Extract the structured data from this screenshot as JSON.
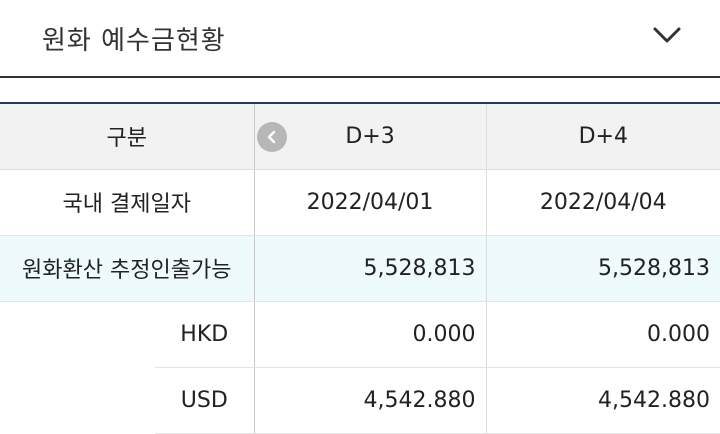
{
  "header": {
    "title": "원화 예수금현황",
    "toggle_icon": "chevron-down-icon"
  },
  "table": {
    "header": {
      "label": "구분",
      "col1": "D+3",
      "col2": "D+4",
      "scroll_icon": "chevron-left-icon"
    },
    "rows": [
      {
        "label": "국내 결제일자",
        "col1": "2022/04/01",
        "col2": "2022/04/04"
      },
      {
        "label": "원화환산 추정인출가능",
        "col1": "5,528,813",
        "col2": "5,528,813"
      },
      {
        "label": "HKD",
        "col1": "0.000",
        "col2": "0.000"
      },
      {
        "label": "USD",
        "col1": "4,542.880",
        "col2": "4,542.880"
      }
    ]
  },
  "colors": {
    "header_underline": "#333333",
    "table_top_border": "#1f3c63",
    "highlight_row": "#eefafc",
    "header_row": "#f2f2f2"
  }
}
